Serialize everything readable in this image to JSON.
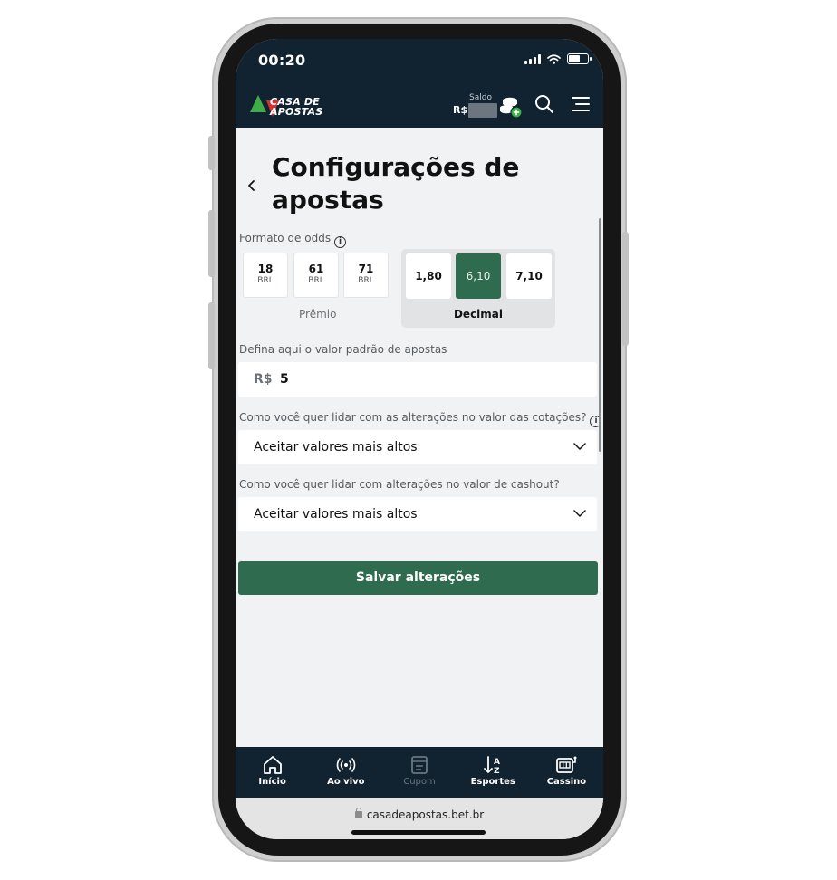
{
  "status_bar": {
    "time": "00:20"
  },
  "header": {
    "logo_line1": "CASA DE",
    "logo_line2": "APOSTAS",
    "balance_label": "Saldo",
    "balance_currency": "R$"
  },
  "page": {
    "title": "Configurações de apostas",
    "odds_format_label": "Formato de odds",
    "premio_options": [
      {
        "value": "18",
        "currency": "BRL"
      },
      {
        "value": "61",
        "currency": "BRL"
      },
      {
        "value": "71",
        "currency": "BRL"
      }
    ],
    "premio_caption": "Prêmio",
    "decimal_options": [
      "1,80",
      "6,10",
      "7,10"
    ],
    "decimal_selected": "6,10",
    "decimal_caption": "Decimal",
    "default_stake_label": "Defina aqui o valor padrão de apostas",
    "default_stake_prefix": "R$",
    "default_stake_value": "5",
    "odds_change_label": "Como você quer lidar com as alterações no valor das cotações?",
    "odds_change_value": "Aceitar valores mais altos",
    "cashout_change_label": "Como você quer lidar com alterações no valor de cashout?",
    "cashout_change_value": "Aceitar valores mais altos",
    "save_button": "Salvar alterações"
  },
  "bottom_nav": [
    {
      "label": "Início",
      "icon": "home-icon"
    },
    {
      "label": "Ao vivo",
      "icon": "live-broadcast-icon"
    },
    {
      "label": "Cupom",
      "icon": "coupon-icon"
    },
    {
      "label": "Esportes",
      "icon": "sort-az-icon"
    },
    {
      "label": "Cassino",
      "icon": "slot-machine-icon"
    }
  ],
  "browser": {
    "url": "casadeapostas.bet.br"
  },
  "colors": {
    "header_bg": "#112230",
    "accent_green": "#2e6b4f",
    "logo_green": "#3fae49",
    "logo_red": "#d62f2f",
    "page_bg": "#f1f2f3"
  }
}
